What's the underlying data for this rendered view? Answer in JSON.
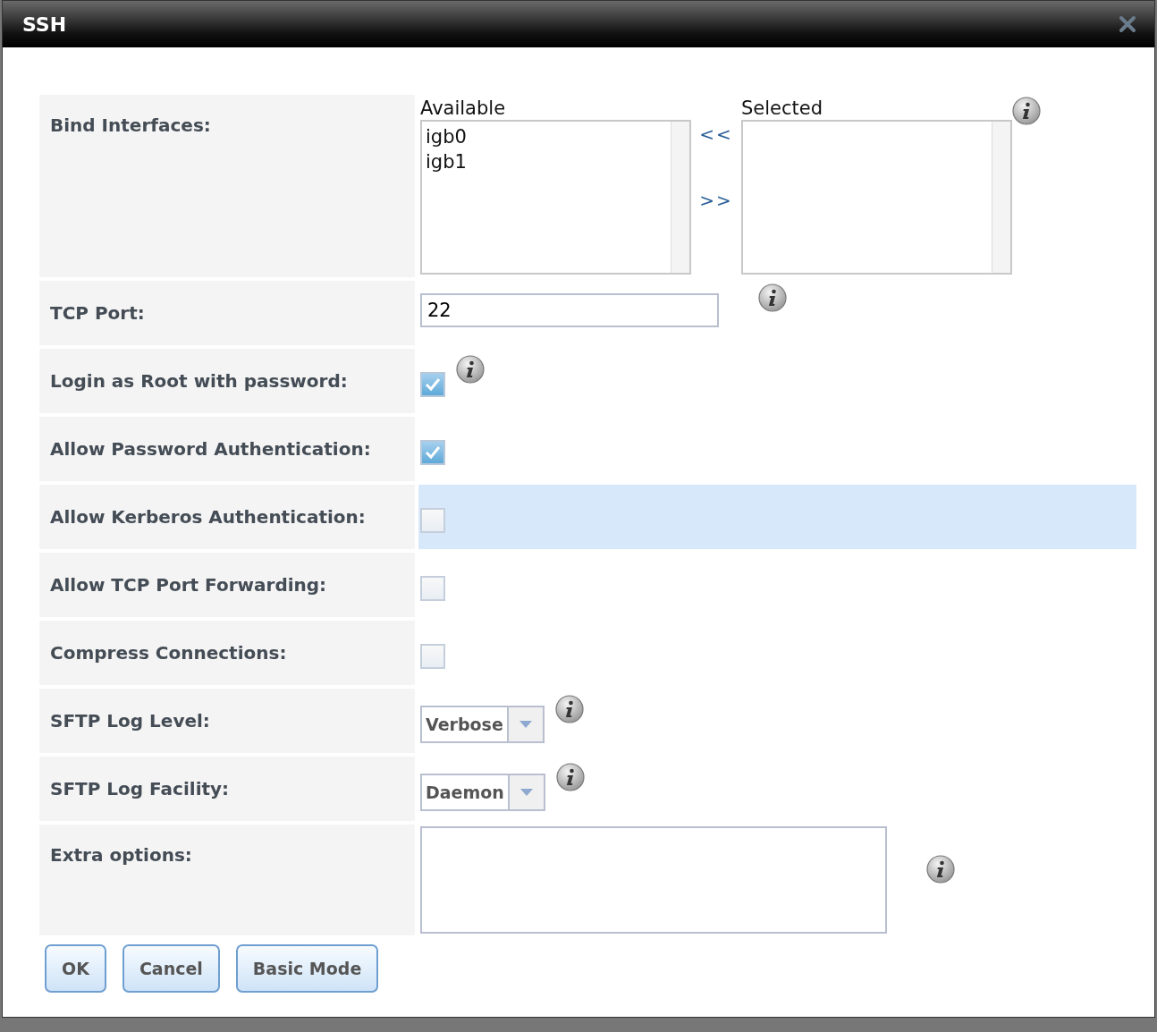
{
  "dialog": {
    "title": "SSH"
  },
  "fields": [
    {
      "kind": "dual_list",
      "label": "Bind Interfaces:",
      "available_title": "Available",
      "available": [
        "igb0",
        "igb1"
      ],
      "remove_arrow": "<<",
      "add_arrow": ">>",
      "selected_title": "Selected",
      "highlighted": false,
      "info": true
    },
    {
      "kind": "text",
      "label": "TCP Port:",
      "value": "22",
      "highlighted": false,
      "info": true
    },
    {
      "kind": "checkbox",
      "label": "Login as Root with password:",
      "checked": true,
      "highlighted": false,
      "info": true
    },
    {
      "kind": "checkbox",
      "label": "Allow Password Authentication:",
      "checked": true,
      "highlighted": false,
      "info": false
    },
    {
      "kind": "checkbox",
      "label": "Allow Kerberos Authentication:",
      "checked": false,
      "highlighted": true,
      "info": false
    },
    {
      "kind": "checkbox",
      "label": "Allow TCP Port Forwarding:",
      "checked": false,
      "highlighted": false,
      "info": false
    },
    {
      "kind": "checkbox",
      "label": "Compress Connections:",
      "checked": false,
      "highlighted": false,
      "info": false
    },
    {
      "kind": "select",
      "label": "SFTP Log Level:",
      "value": "Verbose",
      "highlighted": false,
      "info": true
    },
    {
      "kind": "select",
      "label": "SFTP Log Facility:",
      "value": "Daemon",
      "highlighted": false,
      "info": true
    },
    {
      "kind": "textarea",
      "label": "Extra options:",
      "highlighted": false,
      "info": true
    }
  ],
  "buttons": [
    "OK",
    "Cancel",
    "Basic Mode"
  ]
}
